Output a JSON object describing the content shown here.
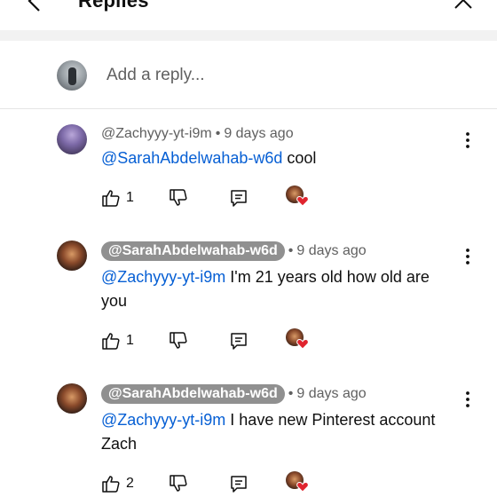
{
  "header": {
    "title": "Replies"
  },
  "compose": {
    "placeholder": "Add a reply..."
  },
  "replies": [
    {
      "author": "@Zachyyy-yt-i9m",
      "author_chip": false,
      "time": "9 days ago",
      "mention": "@SarahAbdelwahab-w6d",
      "text": " cool",
      "likes": "1"
    },
    {
      "author": "@SarahAbdelwahab-w6d",
      "author_chip": true,
      "time": "9 days ago",
      "mention": "@Zachyyy-yt-i9m",
      "text": " I'm 21 years old how old are you",
      "likes": "1"
    },
    {
      "author": "@SarahAbdelwahab-w6d",
      "author_chip": true,
      "time": "9 days ago",
      "mention": "@Zachyyy-yt-i9m",
      "text": " I have new Pinterest account Zach",
      "likes": "2"
    }
  ],
  "colors": {
    "mention": "#065fd4",
    "chip": "#909090",
    "heart": "#e0242e"
  }
}
